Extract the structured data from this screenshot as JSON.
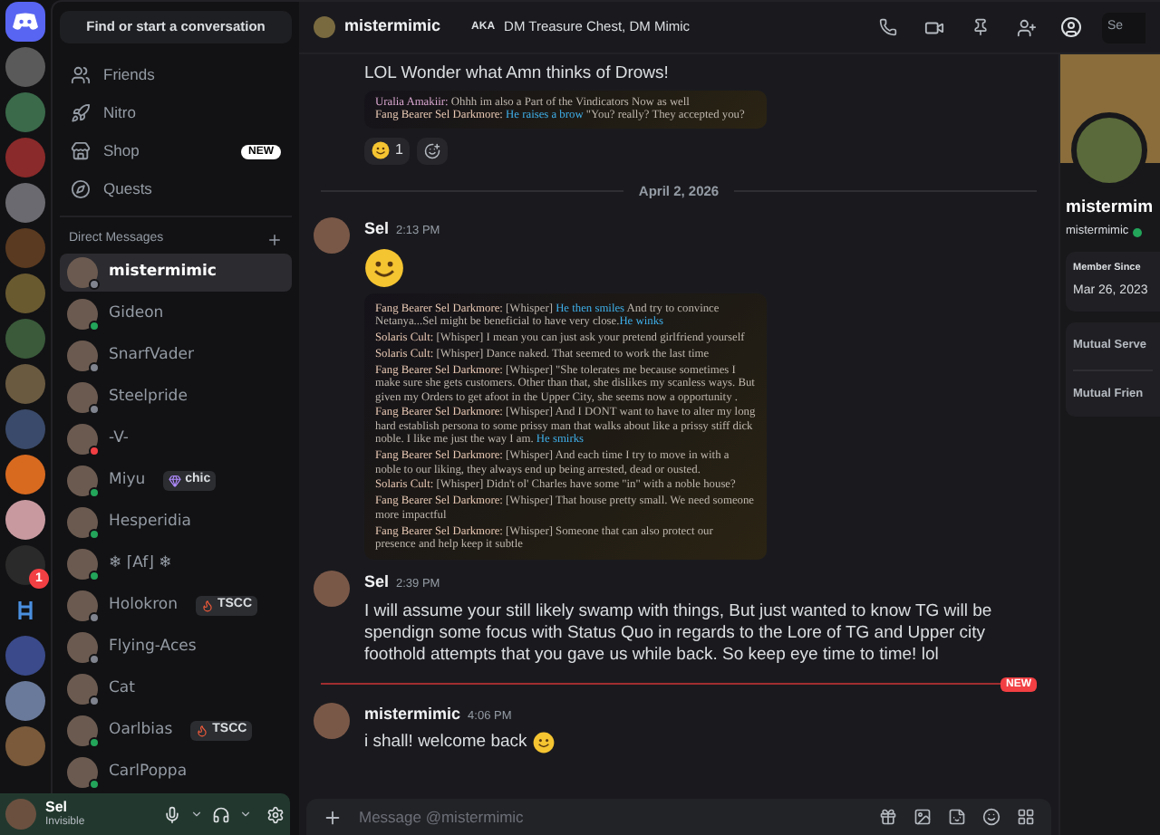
{
  "server_rail": {
    "servers": [
      {
        "kind": "home"
      },
      {
        "kind": "server"
      },
      {
        "kind": "server"
      },
      {
        "kind": "server"
      },
      {
        "kind": "server"
      },
      {
        "kind": "server"
      },
      {
        "kind": "server"
      },
      {
        "kind": "server"
      },
      {
        "kind": "server"
      },
      {
        "kind": "server"
      },
      {
        "kind": "server"
      },
      {
        "kind": "server"
      },
      {
        "kind": "server",
        "badge": "1"
      },
      {
        "kind": "folder"
      },
      {
        "kind": "server"
      },
      {
        "kind": "server"
      },
      {
        "kind": "server"
      }
    ]
  },
  "dm_sidebar": {
    "search": {
      "placeholder": "Find or start a conversation"
    },
    "nav": [
      {
        "label": "Friends"
      },
      {
        "label": "Nitro"
      },
      {
        "label": "Shop",
        "badge": "NEW"
      },
      {
        "label": "Quests"
      }
    ],
    "section_title": "Direct Messages",
    "dms": [
      {
        "name": "mistermimic",
        "selected": true,
        "color": "#80848e"
      },
      {
        "name": "Gideon",
        "selected": false,
        "color": "#23a55a"
      },
      {
        "name": "SnarfVader",
        "selected": false,
        "color": "#80848e"
      },
      {
        "name": "Steelpride",
        "selected": false,
        "color": "#80848e"
      },
      {
        "name": "-V-",
        "selected": false,
        "color": "#f23f43"
      },
      {
        "name": "Miyu",
        "selected": false,
        "color": "#23a55a",
        "tag": {
          "kind": "gem",
          "text": "chic"
        }
      },
      {
        "name": "Hesperidia",
        "selected": false,
        "color": "#23a55a"
      },
      {
        "name": "❄ ⌈Af⌋ ❄",
        "selected": false,
        "color": "#23a55a"
      },
      {
        "name": "Holokron",
        "selected": false,
        "color": "#80848e",
        "tag": {
          "kind": "flame",
          "text": "TSCC"
        }
      },
      {
        "name": "Flying-Aces",
        "selected": false,
        "color": "#80848e"
      },
      {
        "name": "Cat",
        "selected": false,
        "color": "#80848e"
      },
      {
        "name": "Oarlbias",
        "selected": false,
        "color": "#23a55a",
        "tag": {
          "kind": "flame",
          "text": "TSCC"
        }
      },
      {
        "name": "CarlPoppa",
        "selected": false,
        "color": "#23a55a"
      }
    ],
    "user_panel": {
      "name": "Sel",
      "status": "Invisible"
    }
  },
  "header": {
    "name": "mistermimic",
    "aka_label": "AKA",
    "aka": "DM Treasure Chest, DM Mimic",
    "search": {
      "placeholder": "Se"
    }
  },
  "messages": [
    {
      "kind": "message",
      "text": "LOL Wonder what Amn thinks of Drows!",
      "image_lines": [
        [
          {
            "kind": "speaker_alt",
            "text": "Uralia Amakiir:"
          },
          {
            "kind": "say",
            "text": " Ohhh im also a Part of the Vindicators Now as well"
          }
        ],
        [
          {
            "kind": "speaker",
            "text": "Fang Bearer Sel Darkmore:"
          },
          {
            "kind": "emote",
            "text": " He raises a brow"
          },
          {
            "kind": "say",
            "text": " \"You? really? They accepted you?"
          }
        ]
      ],
      "reactions": [
        {
          "count": "1"
        }
      ]
    },
    {
      "kind": "date_divider",
      "text": "April 2, 2026"
    },
    {
      "kind": "message",
      "author": "Sel",
      "time": "2:13 PM",
      "big_emoji": true,
      "image_lines": [
        [
          {
            "kind": "speaker",
            "text": "Fang Bearer Sel Darkmore:"
          },
          {
            "kind": "say",
            "text": " [Whisper] "
          },
          {
            "kind": "emote",
            "text": "He then smiles"
          },
          {
            "kind": "say",
            "text": " And try to convince Netanya...Sel might be beneficial to have very close."
          },
          {
            "kind": "emote",
            "text": "He winks"
          }
        ],
        [
          {
            "kind": "speaker",
            "text": "Solaris Cult:"
          },
          {
            "kind": "say",
            "text": " [Whisper] I mean you can just ask your pretend girlfriend yourself"
          }
        ],
        [
          {
            "kind": "speaker",
            "text": "Solaris Cult:"
          },
          {
            "kind": "say",
            "text": " [Whisper] Dance naked. That seemed to work the last time"
          }
        ],
        [
          {
            "kind": "speaker",
            "text": "Fang Bearer Sel Darkmore:"
          },
          {
            "kind": "say",
            "text": " [Whisper] \"She tolerates me because sometimes I make sure she gets customers. Other than that, she dislikes my scanless ways. But given my Orders to get afoot in the Upper City, she seems now a opportunity ."
          }
        ],
        [
          {
            "kind": "speaker",
            "text": "Fang Bearer Sel Darkmore:"
          },
          {
            "kind": "say",
            "text": " [Whisper] And I DONT want to have to alter my long hard establish persona to some prissy man that walks about like a prissy stiff dick noble. I like me just the way I am. "
          },
          {
            "kind": "emote",
            "text": "He smirks"
          }
        ],
        [
          {
            "kind": "speaker",
            "text": "Fang Bearer Sel Darkmore:"
          },
          {
            "kind": "say",
            "text": " [Whisper] And each time I try to move in with a noble to our liking, they always end up being arrested, dead or ousted."
          }
        ],
        [
          {
            "kind": "speaker",
            "text": "Solaris Cult:"
          },
          {
            "kind": "say",
            "text": " [Whisper] Didn't ol' Charles have some \"in\" with a noble house?"
          }
        ],
        [
          {
            "kind": "speaker",
            "text": "Fang Bearer Sel Darkmore:"
          },
          {
            "kind": "say",
            "text": " [Whisper] That house pretty small. We need someone more impactful"
          }
        ],
        [
          {
            "kind": "speaker",
            "text": "Fang Bearer Sel Darkmore:"
          },
          {
            "kind": "say",
            "text": " [Whisper] Someone that can also protect our presence and help keep it subtle"
          }
        ]
      ]
    },
    {
      "kind": "message",
      "author": "Sel",
      "time": "2:39 PM",
      "text": "I will assume your still likely swamp with things, But just wanted to know TG will be spendign some focus with Status Quo in regards to the Lore of TG and Upper city foothold attempts that you gave us while back. So keep eye time to time! lol"
    },
    {
      "kind": "new_divider",
      "text": "NEW"
    },
    {
      "kind": "message",
      "author": "mistermimic",
      "time": "4:06 PM",
      "text": "i shall! welcome back",
      "trailing_emoji": true
    }
  ],
  "composer": {
    "placeholder": "Message @mistermimic"
  },
  "profile": {
    "name": "mistermim",
    "username": "mistermimic",
    "member_since_label": "Member Since",
    "member_since": "Mar 26, 2023",
    "mutuals": [
      "Mutual Serve",
      "Mutual Frien"
    ]
  }
}
